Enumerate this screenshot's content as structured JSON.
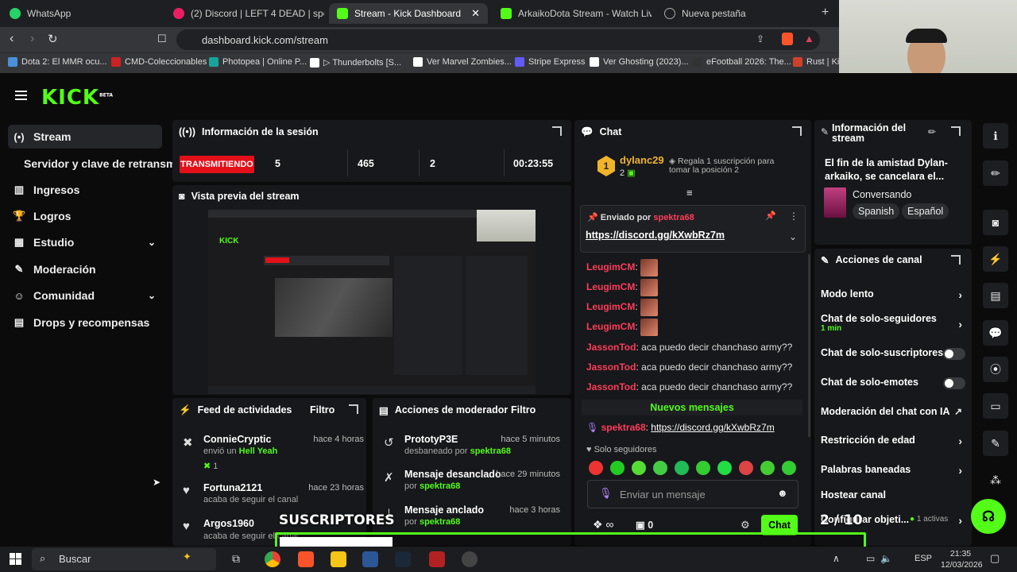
{
  "browser": {
    "tabs": [
      {
        "label": "WhatsApp",
        "color": "#25d366"
      },
      {
        "label": "(2) Discord | LEFT 4 DEAD | spekt",
        "color": "#e91e63"
      },
      {
        "label": "Stream - Kick Dashboard",
        "color": "#53fc18",
        "active": true
      },
      {
        "label": "ArkaikoDota Stream - Watch Live",
        "color": "#53fc18"
      },
      {
        "label": "Nueva pestaña",
        "color": "#888888"
      }
    ],
    "new_tab": "+",
    "url": "dashboard.kick.com/stream",
    "bookmarks": [
      {
        "label": "Dota 2: El MMR ocu...",
        "color": "#4a90d9"
      },
      {
        "label": "CMD-Coleccionables",
        "color": "#cc2222"
      },
      {
        "label": "Photopea | Online P...",
        "color": "#18a497"
      },
      {
        "label": "▷ Thunderbolts [S...",
        "color": "#ffffff"
      },
      {
        "label": "Ver Marvel Zombies...",
        "color": "#ffffff"
      },
      {
        "label": "Stripe Express",
        "color": "#635bff"
      },
      {
        "label": "Ver Ghosting (2023)...",
        "color": "#ffffff"
      },
      {
        "label": "eFootball 2026: The...",
        "color": "#333333"
      },
      {
        "label": "Rust | Kic",
        "color": "#cd412b"
      }
    ]
  },
  "kick": {
    "logo": "KICK",
    "beta": "BETA",
    "accent": "#53fc18",
    "sidebar": [
      {
        "label": "Stream",
        "icon": "broadcast-icon",
        "selected": true
      },
      {
        "label": "Servidor y clave de retransm",
        "icon": ""
      },
      {
        "label": "Ingresos",
        "icon": "bank-icon"
      },
      {
        "label": "Logros",
        "icon": "trophy-icon"
      },
      {
        "label": "Estudio",
        "icon": "grid-icon",
        "chevron": true
      },
      {
        "label": "Moderación",
        "icon": "wrench-icon"
      },
      {
        "label": "Comunidad",
        "icon": "people-icon",
        "chevron": true
      },
      {
        "label": "Drops y recompensas",
        "icon": "gift-icon"
      }
    ],
    "session": {
      "title": "Información de la sesión",
      "live_badge": "TRANSMITIENDO",
      "viewers": "5",
      "followers": "465",
      "subs": "2",
      "duration": "00:23:55"
    },
    "preview": {
      "title": "Vista previa del stream"
    },
    "activity": {
      "title": "Feed de actividades",
      "filter": "Filtro",
      "items": [
        {
          "name": "ConnieCryptic",
          "time": "hace 4 horas",
          "action": "envió un",
          "highlight": "Hell Yeah",
          "count": "1"
        },
        {
          "name": "Fortuna2121",
          "time": "hace 23 horas",
          "action": "acaba de seguir el canal"
        },
        {
          "name": "Argos1960",
          "time": "",
          "action": "acaba de seguir el canal"
        }
      ]
    },
    "modactions": {
      "title": "Acciones de moderador",
      "filter": "Filtro",
      "items": [
        {
          "name": "PrototyP3E",
          "time": "hace 5 minutos",
          "action": "desbaneado por",
          "by": "spektra68"
        },
        {
          "name": "Mensaje desanclado",
          "time": "hace 29 minutos",
          "action": "por",
          "by": "spektra68"
        },
        {
          "name": "Mensaje anclado",
          "time": "hace 3 horas",
          "action": "por",
          "by": "spektra68"
        }
      ]
    },
    "chat": {
      "title": "Chat",
      "top_user": "dylanc29",
      "top_rank": "1",
      "top_count": "2",
      "gift_text": "Regala 1 suscripción para tomar la posición 2",
      "pinned_label": "Enviado por",
      "pinned_user": "spektra68",
      "pinned_link": "https://discord.gg/kXwbRz7m",
      "messages": [
        {
          "user": "LeugimCM",
          "text": ""
        },
        {
          "user": "LeugimCM",
          "text": ""
        },
        {
          "user": "LeugimCM",
          "text": ""
        },
        {
          "user": "LeugimCM",
          "text": ""
        },
        {
          "user": "JassonTod",
          "text": "aca puedo decir chanchaso army??"
        },
        {
          "user": "JassonTod",
          "text": "aca puedo decir chanchaso army??"
        },
        {
          "user": "JassonTod",
          "text": "aca puedo decir chanchaso army??"
        }
      ],
      "new_messages": "Nuevos mensajes",
      "last_user": "spektra68",
      "last_link": "https://discord.gg/kXwbRz7m",
      "followers_only": "Solo seguidores",
      "input_placeholder": "Enviar un mensaje",
      "points": "∞",
      "zero": "0",
      "send": "Chat"
    },
    "streaminfo": {
      "title": "Información del stream",
      "stream_title": "El fin de la amistad Dylan-arkaiko, se cancelara el...",
      "category": "Conversando",
      "tags": [
        "Spanish",
        "Español"
      ]
    },
    "channel_actions": {
      "title": "Acciones de canal",
      "items": [
        {
          "label": "Modo lento",
          "type": "arrow"
        },
        {
          "label": "Chat de solo-seguidores",
          "sub": "1 min",
          "type": "arrow"
        },
        {
          "label": "Chat de solo-suscriptores",
          "type": "toggle"
        },
        {
          "label": "Chat de solo-emotes",
          "type": "toggle"
        },
        {
          "label": "Moderación del chat con IA",
          "type": "external"
        },
        {
          "label": "Restricción de edad",
          "type": "arrow"
        },
        {
          "label": "Palabras baneadas",
          "type": "arrow"
        },
        {
          "label": "Hostear canal",
          "type": "none"
        },
        {
          "label": "Configurar objeti...",
          "sub": "1 activas",
          "type": "arrow"
        }
      ]
    }
  },
  "overlay": {
    "label": "SUSCRIPTORES",
    "count": "2 / 10"
  },
  "taskbar": {
    "search": "Buscar",
    "lang": "ESP",
    "time": "21:35",
    "date": "12/03/2026"
  }
}
